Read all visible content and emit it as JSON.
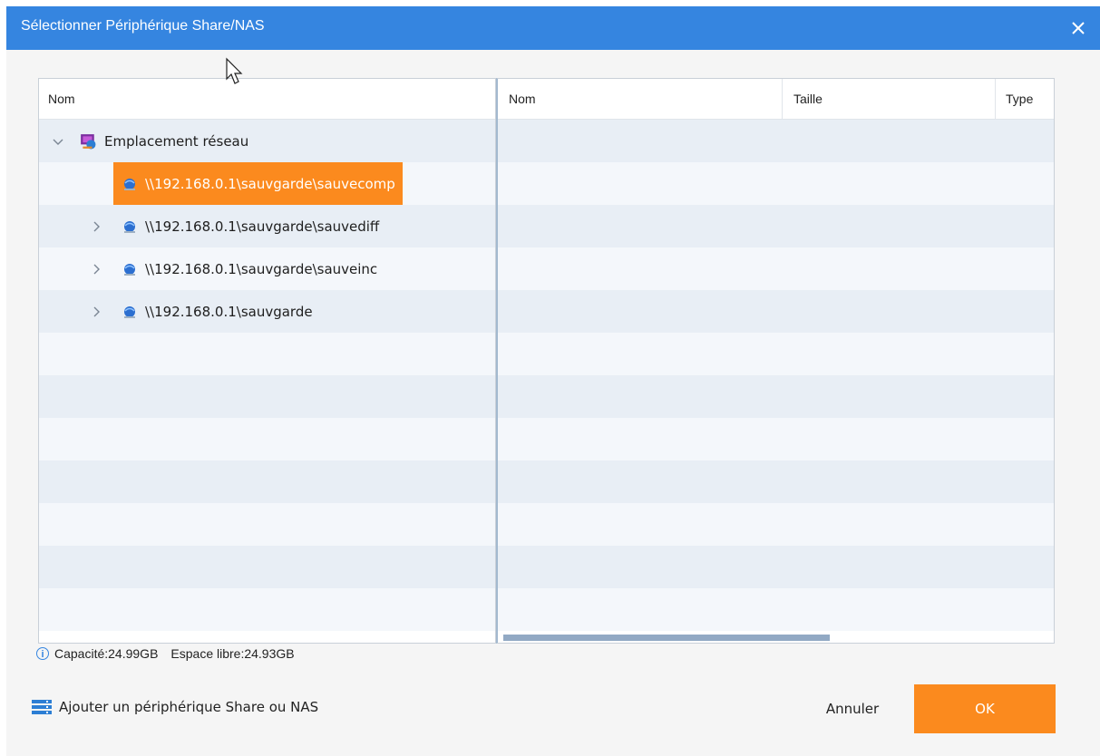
{
  "window": {
    "title": "Sélectionner Périphérique Share/NAS"
  },
  "left_panel": {
    "column_header": "Nom",
    "tree": [
      {
        "label": "Emplacement réseau",
        "level": 0,
        "expanded": true,
        "icon": "network-location-icon"
      },
      {
        "label": "\\\\192.168.0.1\\sauvgarde\\sauvecomp",
        "level": 1,
        "selected": true,
        "icon": "network-share-icon"
      },
      {
        "label": "\\\\192.168.0.1\\sauvgarde\\sauvediff",
        "level": 1,
        "collapsed": true,
        "icon": "network-share-icon"
      },
      {
        "label": "\\\\192.168.0.1\\sauvgarde\\sauveinc",
        "level": 1,
        "collapsed": true,
        "icon": "network-share-icon"
      },
      {
        "label": "\\\\192.168.0.1\\sauvgarde",
        "level": 1,
        "collapsed": true,
        "icon": "network-share-icon"
      }
    ]
  },
  "right_panel": {
    "columns": [
      "Nom",
      "Taille",
      "Type"
    ]
  },
  "info": {
    "capacity": "Capacité:24.99GB",
    "free_space": "Espace libre:24.93GB"
  },
  "footer": {
    "add_link": "Ajouter un périphérique Share ou NAS",
    "cancel_label": "Annuler",
    "ok_label": "OK"
  },
  "colors": {
    "title_bar": "#3585e0",
    "accent": "#fb8a1e",
    "row_alt": "#e8eef5"
  }
}
